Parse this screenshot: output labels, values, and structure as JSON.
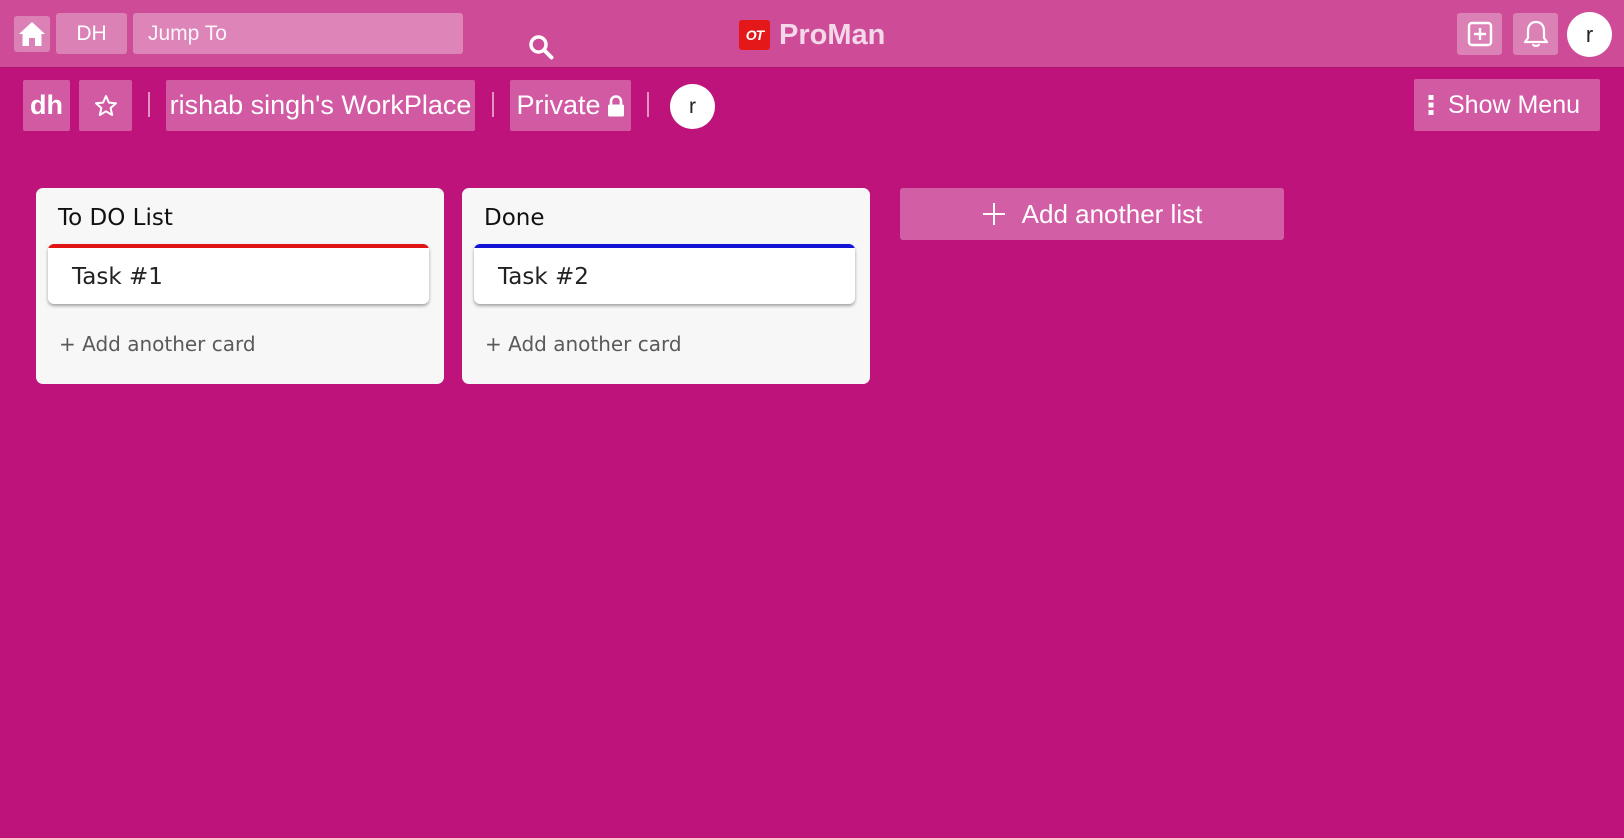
{
  "topbar": {
    "board_short": "DH",
    "search_placeholder": "Jump To",
    "brand_logo_text": "OT",
    "brand_name": "ProMan",
    "user_initial": "r",
    "icons": {
      "home": "home-icon",
      "search": "search-icon",
      "add": "add-square-icon",
      "notifications": "bell-icon"
    }
  },
  "board_header": {
    "board_initials": "dh",
    "workspace": "rishab singh's WorkPlace",
    "visibility": "Private",
    "member_initial": "r",
    "menu_label": "Show Menu",
    "icons": {
      "star": "star-icon",
      "lock": "lock-icon",
      "menu": "vertical-dots-icon"
    }
  },
  "lists": [
    {
      "title": "To DO List",
      "cards": [
        {
          "title": "Task #1",
          "label_color": "#e01414"
        }
      ],
      "add_card_label": "+ Add another card"
    },
    {
      "title": "Done",
      "cards": [
        {
          "title": "Task #2",
          "label_color": "#1414d6"
        }
      ],
      "add_card_label": "+ Add another card"
    }
  ],
  "add_list_label": "Add another list",
  "colors": {
    "board_background": "#bd137b",
    "topbar_background": "#cd4b97",
    "list_background": "#f7f7f7"
  }
}
